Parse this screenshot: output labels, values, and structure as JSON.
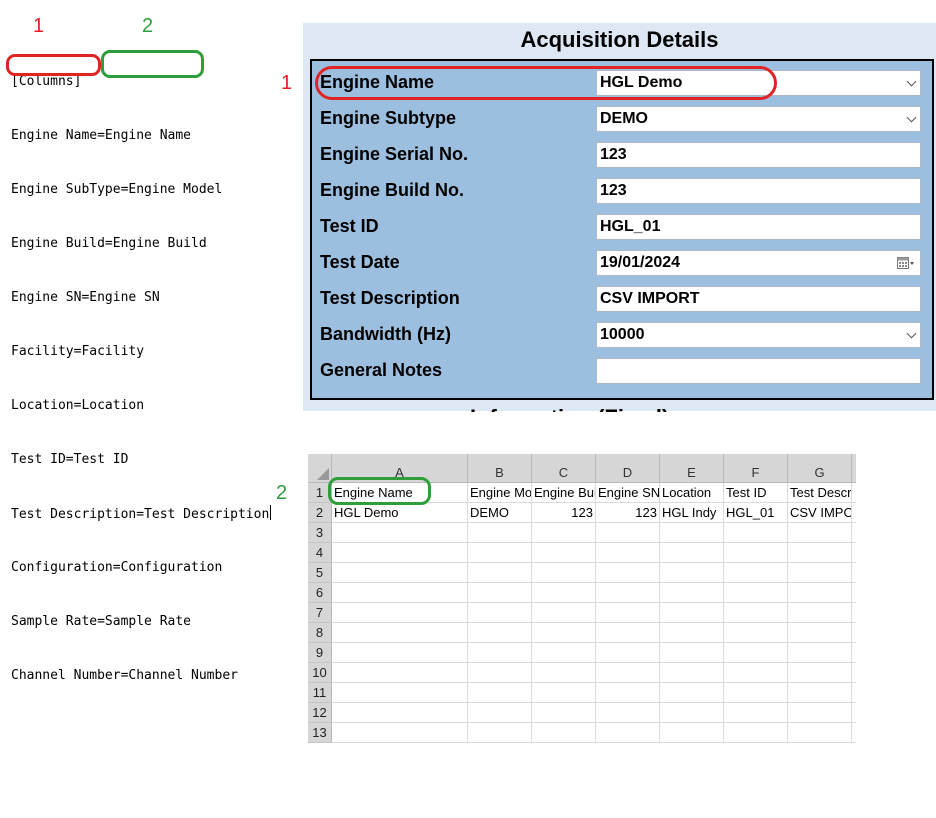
{
  "annotations": {
    "one": "1",
    "two": "2"
  },
  "ini": {
    "lines": [
      "[Columns]",
      "Engine Name=Engine Name",
      "Engine SubType=Engine Model",
      "Engine Build=Engine Build",
      "Engine SN=Engine SN",
      "Facility=Facility",
      "Location=Location",
      "Test ID=Test ID",
      "Test Description=Test Description",
      "Configuration=Configuration",
      "Sample Rate=Sample Rate",
      "Channel Number=Channel Number"
    ]
  },
  "form": {
    "title": "Acquisition Details",
    "fields": [
      {
        "label": "Engine Name",
        "value": "HGL Demo",
        "kind": "dropdown"
      },
      {
        "label": "Engine Subtype",
        "value": "DEMO",
        "kind": "dropdown"
      },
      {
        "label": "Engine Serial No.",
        "value": "123",
        "kind": "text"
      },
      {
        "label": "Engine Build No.",
        "value": "123",
        "kind": "text"
      },
      {
        "label": "Test ID",
        "value": "HGL_01",
        "kind": "text"
      },
      {
        "label": "Test Date",
        "value": "19/01/2024",
        "kind": "date"
      },
      {
        "label": "Test Description",
        "value": "CSV IMPORT",
        "kind": "text"
      },
      {
        "label": "Bandwidth (Hz)",
        "value": "10000",
        "kind": "dropdown"
      },
      {
        "label": "General Notes",
        "value": "",
        "kind": "text"
      }
    ],
    "cutoff_text": "Information (Fixed)"
  },
  "sheet": {
    "columns": [
      "A",
      "B",
      "C",
      "D",
      "E",
      "F",
      "G"
    ],
    "rows": [
      "1",
      "2",
      "3",
      "4",
      "5",
      "6",
      "7",
      "8",
      "9",
      "10",
      "11",
      "12",
      "13"
    ],
    "header_row": [
      "Engine Name",
      "Engine Model",
      "Engine Build",
      "Engine SN",
      "Location",
      "Test ID",
      "Test Description"
    ],
    "data_row": [
      "HGL Demo",
      "DEMO",
      "123",
      "123",
      "HGL Indy",
      "HGL_01",
      "CSV IMPORT"
    ]
  },
  "colors": {
    "red": "#e02424",
    "green": "#2e9e3a",
    "form_blue": "#9dbfdf"
  },
  "icons": {
    "dropdown": "chevron-down-icon",
    "date": "calendar-icon"
  }
}
